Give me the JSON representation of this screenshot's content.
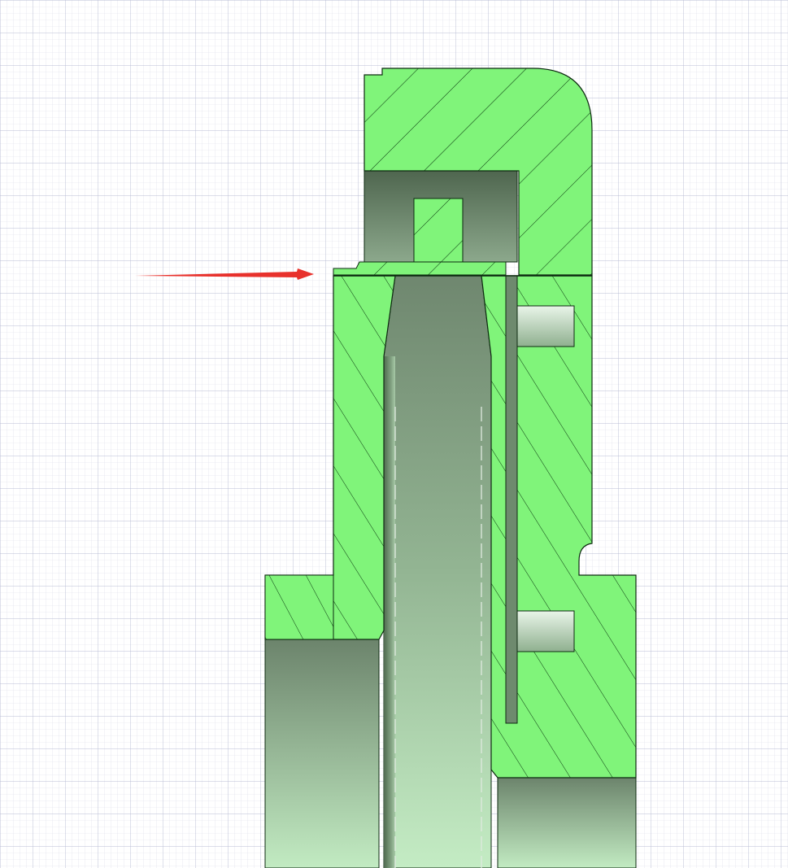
{
  "canvas": {
    "background": "#ffffff",
    "grid_minor_color": "#d9dbe8",
    "grid_major_color": "#b9bcd4"
  },
  "section": {
    "fill_color": "#80f47a",
    "hatch_color": "#0b3a10",
    "outline_color": "#0d2a10",
    "cavity_top_color": "#6f876f",
    "cavity_bottom_color": "#c4ecc4"
  },
  "annotation": {
    "type": "arrow",
    "color": "#e8312c",
    "icon": "arrow-right-icon"
  },
  "parts": [
    "top-cap",
    "tube",
    "flange",
    "pin-groove",
    "upper-dowel-hole",
    "lower-dowel-hole"
  ]
}
